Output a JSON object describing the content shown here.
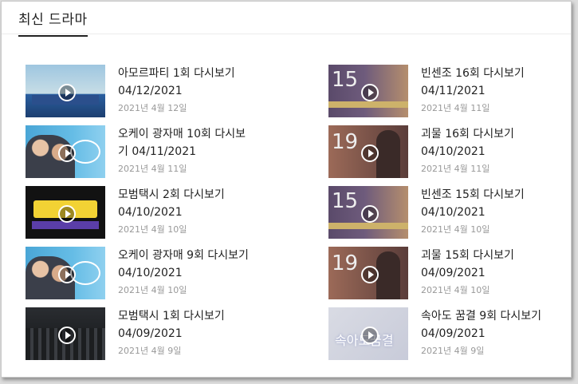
{
  "section_title": "최신 드라마",
  "left": [
    {
      "title": "아모르파티 1회 다시보기 04/12/2021",
      "date": "2021년 4월 12일",
      "thumb": "amor"
    },
    {
      "title": "오케이 광자매 10회 다시보기 04/11/2021",
      "date": "2021년 4월 11일",
      "thumb": "okay"
    },
    {
      "title": "모범택시 2회 다시보기 04/10/2021",
      "date": "2021년 4월 10일",
      "thumb": "taxi"
    },
    {
      "title": "오케이 광자매 9회 다시보기 04/10/2021",
      "date": "2021년 4월 10일",
      "thumb": "okay"
    },
    {
      "title": "모범택시 1회 다시보기 04/09/2021",
      "date": "2021년 4월 9일",
      "thumb": "taxi2"
    }
  ],
  "right": [
    {
      "title": "빈센조 16회 다시보기 04/11/2021",
      "date": "2021년 4월 11일",
      "thumb": "vin",
      "num": "15"
    },
    {
      "title": "괴물 16회 다시보기 04/10/2021",
      "date": "2021년 4월 11일",
      "thumb": "mon",
      "num": "19"
    },
    {
      "title": "빈센조 15회 다시보기 04/10/2021",
      "date": "2021년 4월 10일",
      "thumb": "vin",
      "num": "15"
    },
    {
      "title": "괴물 15회 다시보기 04/09/2021",
      "date": "2021년 4월 10일",
      "thumb": "mon",
      "num": "19"
    },
    {
      "title": "속아도 꿈결 9회 다시보기 04/09/2021",
      "date": "2021년 4월 9일",
      "thumb": "sok",
      "num": "속아도꿈결"
    }
  ]
}
